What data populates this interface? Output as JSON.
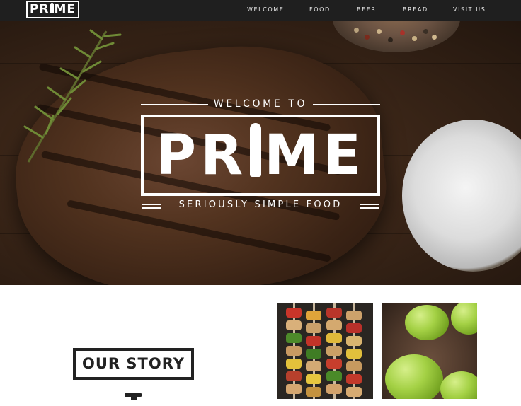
{
  "brand": {
    "logo_prefix": "PR",
    "logo_suffix": "ME"
  },
  "nav": {
    "items": [
      {
        "label": "WELCOME"
      },
      {
        "label": "FOOD"
      },
      {
        "label": "BEER"
      },
      {
        "label": "BREAD"
      },
      {
        "label": "VISIT US"
      }
    ]
  },
  "hero": {
    "welcome_text": "WELCOME TO",
    "title_prefix": "PR",
    "title_suffix": "ME",
    "tagline": "SERIOUSLY SIMPLE FOOD"
  },
  "story": {
    "heading": "OUR STORY"
  },
  "colors": {
    "nav_bg": "#1f1f1f",
    "text_light": "#ffffff",
    "text_dark": "#222222"
  }
}
